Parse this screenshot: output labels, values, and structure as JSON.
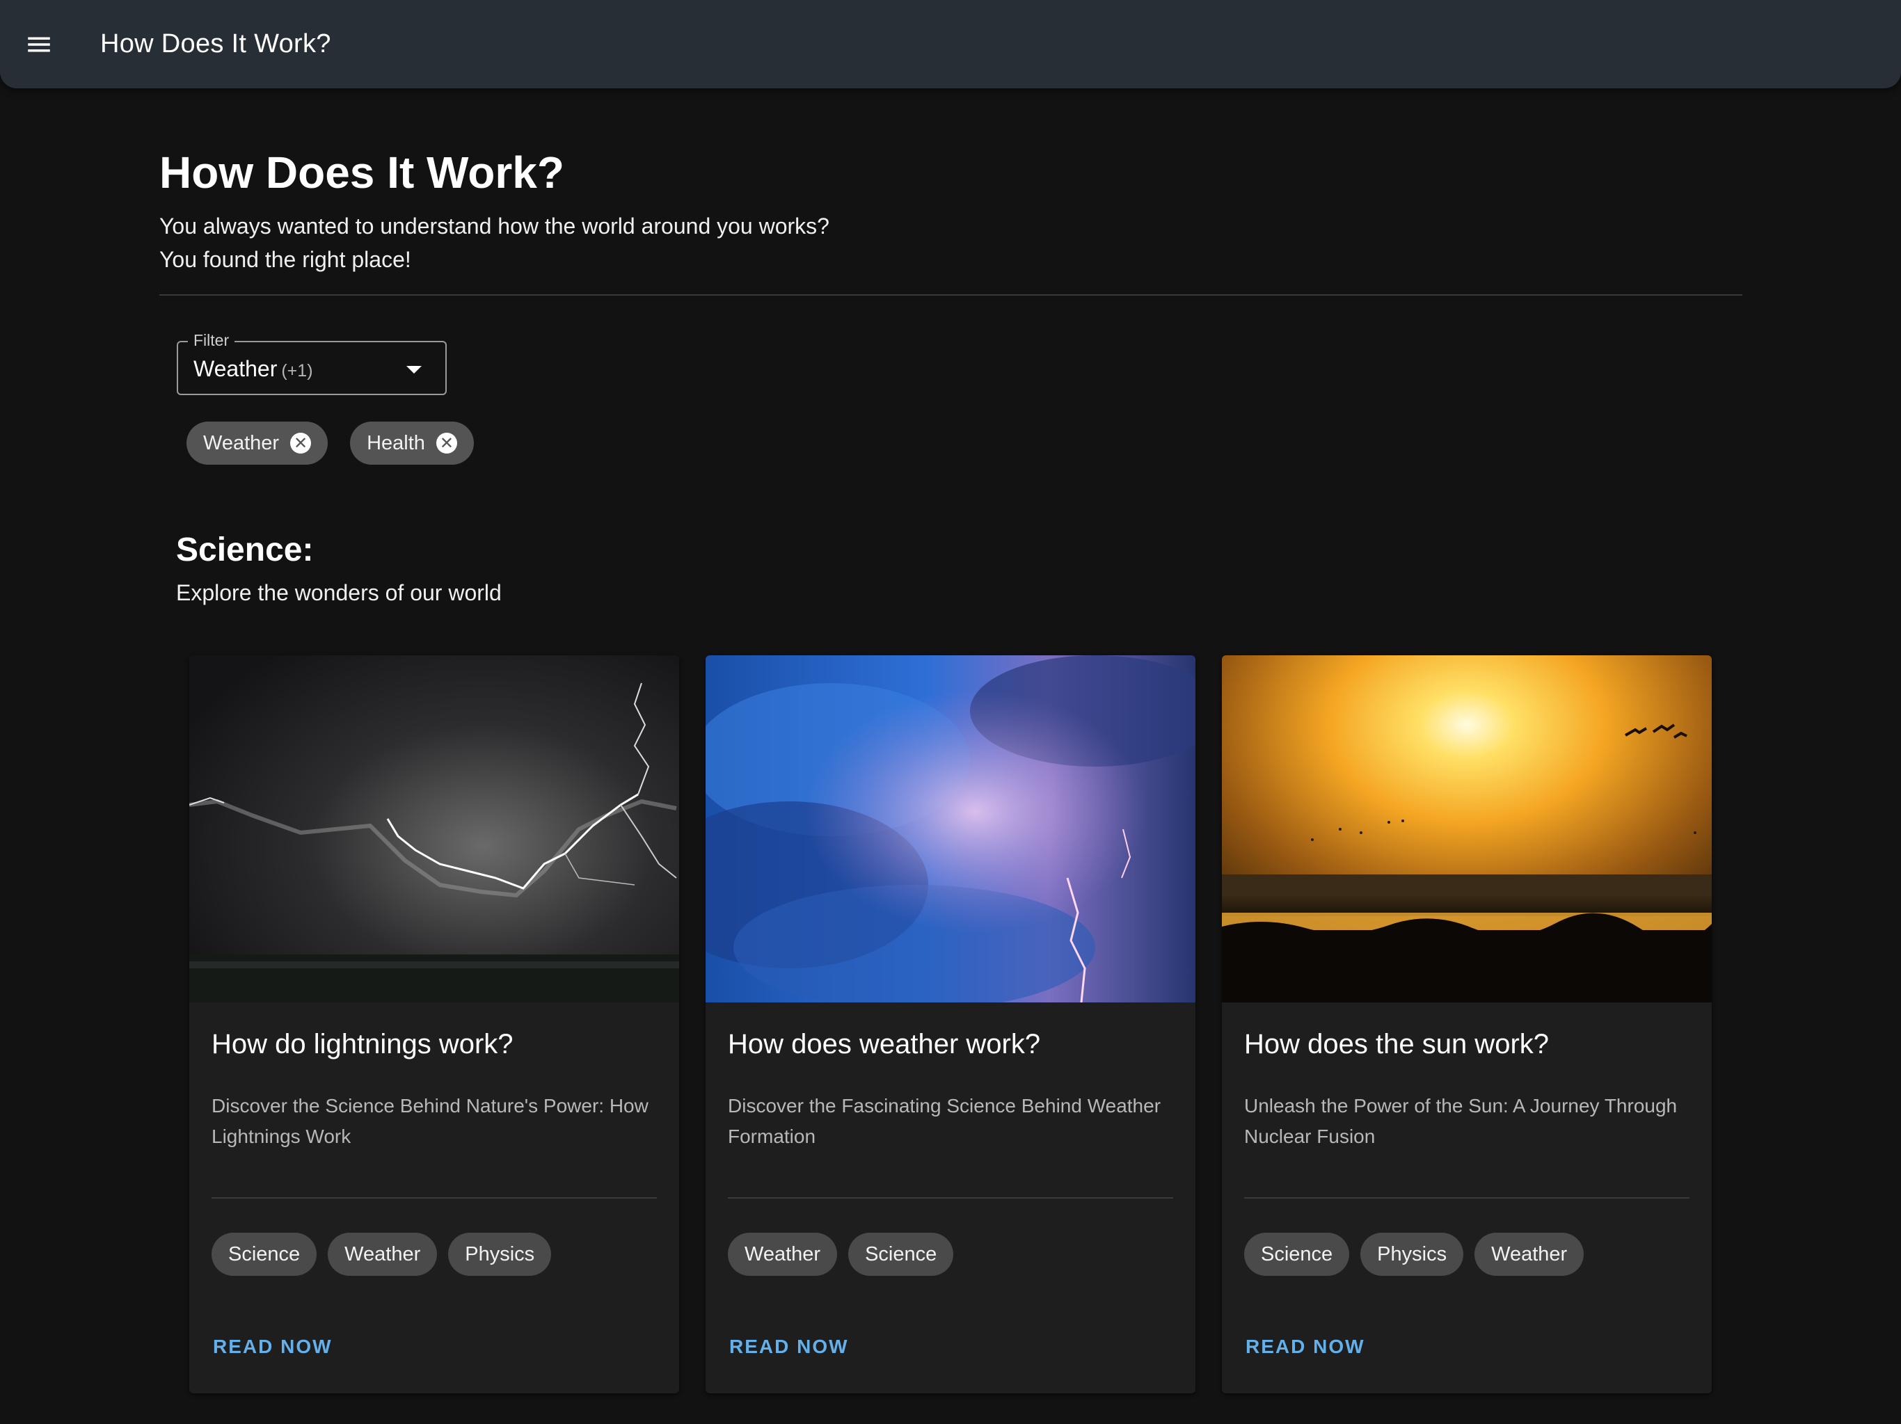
{
  "appbar": {
    "menu_icon": "menu-icon",
    "title": "How Does It Work?"
  },
  "header": {
    "title": "How Does It Work?",
    "subtitle_line1": "You always wanted to understand how the world around you works?",
    "subtitle_line2": "You found the right place!"
  },
  "filter": {
    "label": "Filter",
    "value": "Weather",
    "extra_count": "(+1)",
    "dropdown_icon": "arrow-drop-down-icon",
    "selected_chips": [
      {
        "label": "Weather",
        "remove_icon": "cancel-icon"
      },
      {
        "label": "Health",
        "remove_icon": "cancel-icon"
      }
    ]
  },
  "section": {
    "title": "Science:",
    "subtitle": "Explore the wonders of our world"
  },
  "cards": [
    {
      "image": "lightning storm over plain, black and white",
      "title": "How do lightnings work?",
      "description": "Discover the Science Behind Nature's Power: How Lightnings Work",
      "tags": [
        "Science",
        "Weather",
        "Physics"
      ],
      "action": "READ NOW"
    },
    {
      "image": "blue and purple thunderstorm clouds with lightning",
      "title": "How does weather work?",
      "description": "Discover the Fascinating Science Behind Weather Formation",
      "tags": [
        "Weather",
        "Science"
      ],
      "action": "READ NOW"
    },
    {
      "image": "orange sunset over lake with birds",
      "title": "How does the sun work?",
      "description": "Unleash the Power of the Sun: A Journey Through Nuclear Fusion",
      "tags": [
        "Science",
        "Physics",
        "Weather"
      ],
      "action": "READ NOW"
    }
  ],
  "colors": {
    "background": "#121212",
    "appbar": "#272e36",
    "card": "#1e1e1e",
    "chip": "#545454",
    "accent": "#64b0ea"
  }
}
